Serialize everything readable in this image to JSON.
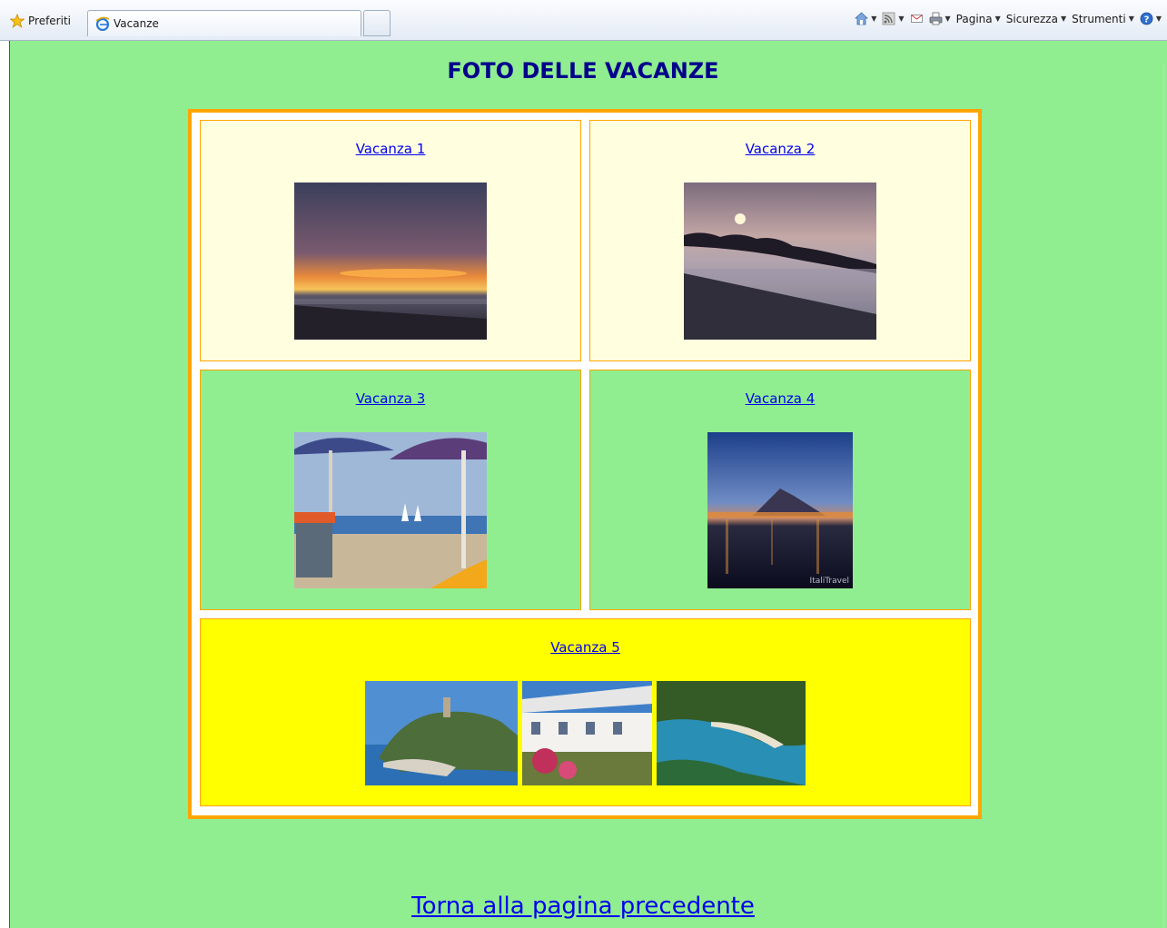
{
  "toolbar": {
    "favorites_label": "Preferiti",
    "tab_title": "Vacanze",
    "pagina_label": "Pagina",
    "sicurezza_label": "Sicurezza",
    "strumenti_label": "Strumenti"
  },
  "page": {
    "title": "FOTO DELLE VACANZE",
    "background_color": "#90ee90",
    "frame_border_color": "#ffa500",
    "link_color": "#0000ee",
    "title_color": "#00008b",
    "cells": [
      {
        "label": "Vacanza 1",
        "background": "#ffffe0",
        "photos": [
          "sunset-sea-photo"
        ]
      },
      {
        "label": "Vacanza 2",
        "background": "#ffffe0",
        "photos": [
          "sunset-rocks-beach-photo"
        ]
      },
      {
        "label": "Vacanza 3",
        "background": "#90ee90",
        "photos": [
          "beach-umbrellas-photo"
        ]
      },
      {
        "label": "Vacanza 4",
        "background": "#90ee90",
        "photos": [
          "bay-night-volcano-photo"
        ]
      },
      {
        "label": "Vacanza 5",
        "background": "#ffff00",
        "photos": [
          "island-tower-photo",
          "hotel-terrace-photo",
          "cove-forest-photo"
        ]
      }
    ],
    "photo4_watermark": "ItaliTravel",
    "back_link": "Torna alla pagina precedente"
  }
}
